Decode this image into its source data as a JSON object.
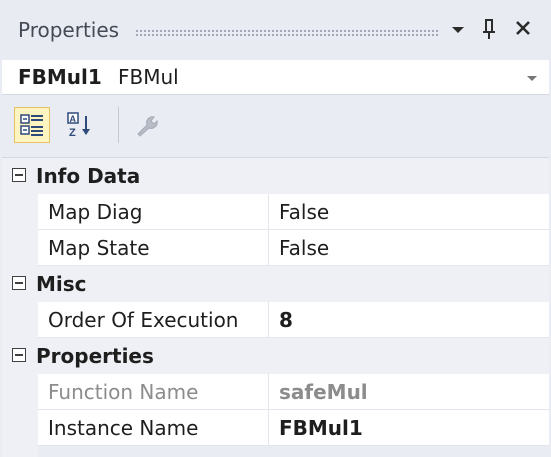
{
  "panel": {
    "title": "Properties"
  },
  "selector": {
    "object_name": "FBMul1",
    "object_type": "FBMul"
  },
  "toolbar": {
    "categorized_icon": "categorized-icon",
    "alphabetical_icon": "alphabetical-icon",
    "property_pages_icon": "wrench-icon"
  },
  "grid": {
    "categories": [
      {
        "label": "Info Data",
        "rows": [
          {
            "name": "Map Diag",
            "value": "False"
          },
          {
            "name": "Map State",
            "value": "False"
          }
        ]
      },
      {
        "label": "Misc",
        "rows": [
          {
            "name": "Order Of Execution",
            "value": "8"
          }
        ]
      },
      {
        "label": "Properties",
        "rows": [
          {
            "name": "Function Name",
            "value": "safeMul"
          },
          {
            "name": "Instance Name",
            "value": "FBMul1"
          }
        ]
      }
    ]
  },
  "colors": {
    "panel_bg": "#e9ecf3",
    "active_tool_bg": "#fdf4bf",
    "readonly_text": "#8c8c8c"
  }
}
